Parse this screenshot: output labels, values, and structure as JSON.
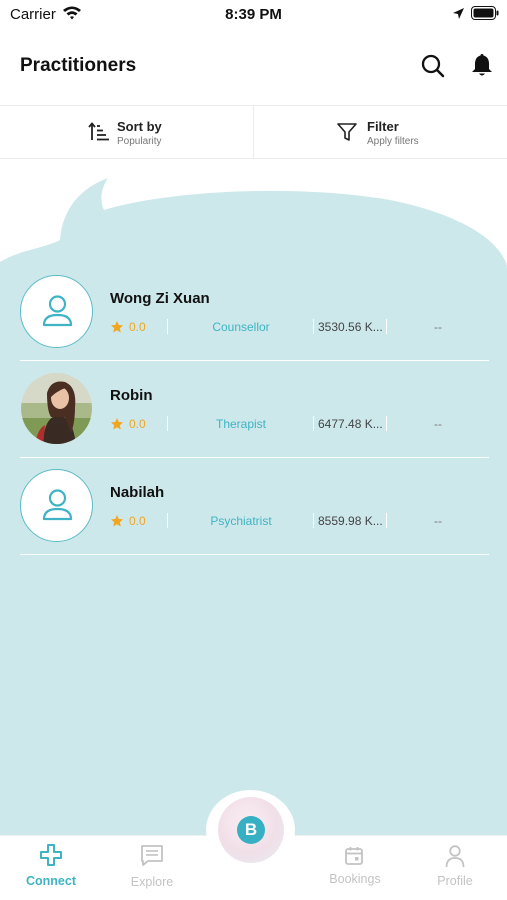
{
  "status_bar": {
    "carrier": "Carrier",
    "time": "8:39 PM"
  },
  "header": {
    "title": "Practitioners",
    "search_icon": "search-icon",
    "bell_icon": "bell-icon"
  },
  "controls": {
    "sort": {
      "title": "Sort by",
      "subtitle": "Popularity",
      "icon": "sort-ascending-icon"
    },
    "filter": {
      "title": "Filter",
      "subtitle": "Apply filters",
      "icon": "funnel-icon"
    }
  },
  "practitioners": [
    {
      "name": "Wong Zi Xuan",
      "rating": "0.0",
      "role": "Counsellor",
      "distance": "3530.56 K...",
      "extra": "--",
      "avatar": "person-icon"
    },
    {
      "name": "Robin",
      "rating": "0.0",
      "role": "Therapist",
      "distance": "6477.48 K...",
      "extra": "--",
      "avatar": "photo"
    },
    {
      "name": "Nabilah",
      "rating": "0.0",
      "role": "Psychiatrist",
      "distance": "8559.98 K...",
      "extra": "--",
      "avatar": "person-icon"
    }
  ],
  "bottom_nav": {
    "items": [
      {
        "label": "Connect",
        "icon": "plus-icon",
        "active": true
      },
      {
        "label": "Explore",
        "icon": "chat-icon",
        "active": false
      },
      {
        "label": "Bookings",
        "icon": "calendar-icon",
        "active": false
      },
      {
        "label": "Profile",
        "icon": "person-icon",
        "active": false
      }
    ],
    "center_logo": "B"
  },
  "colors": {
    "accent": "#3fb3c4",
    "background_blob": "#cde8eb",
    "star": "#f2a51f"
  }
}
